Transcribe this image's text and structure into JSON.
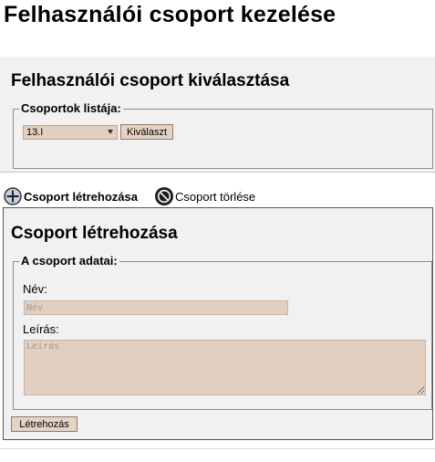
{
  "page": {
    "title": "Felhasználói csoport kezelése"
  },
  "select_section": {
    "heading": "Felhasználói csoport kiválasztása",
    "legend": "Csoportok listája:",
    "selected_group": "13.I",
    "select_button": "Kiválaszt"
  },
  "actions": {
    "create_label": "Csoport létrehozása",
    "create_icon": "plus-circle-icon",
    "delete_label": "Csoport törlése",
    "delete_icon": "no-entry-icon"
  },
  "create_section": {
    "heading": "Csoport létrehozása",
    "legend": "A csoport adatai:",
    "name_label": "Név:",
    "name_placeholder": "Név",
    "name_value": "",
    "description_label": "Leírás:",
    "description_placeholder": "Leírás",
    "description_value": "",
    "submit_button": "Létrehozás"
  },
  "colors": {
    "input_background": "#e2cfc0",
    "panel_background": "#f1f1f1"
  }
}
